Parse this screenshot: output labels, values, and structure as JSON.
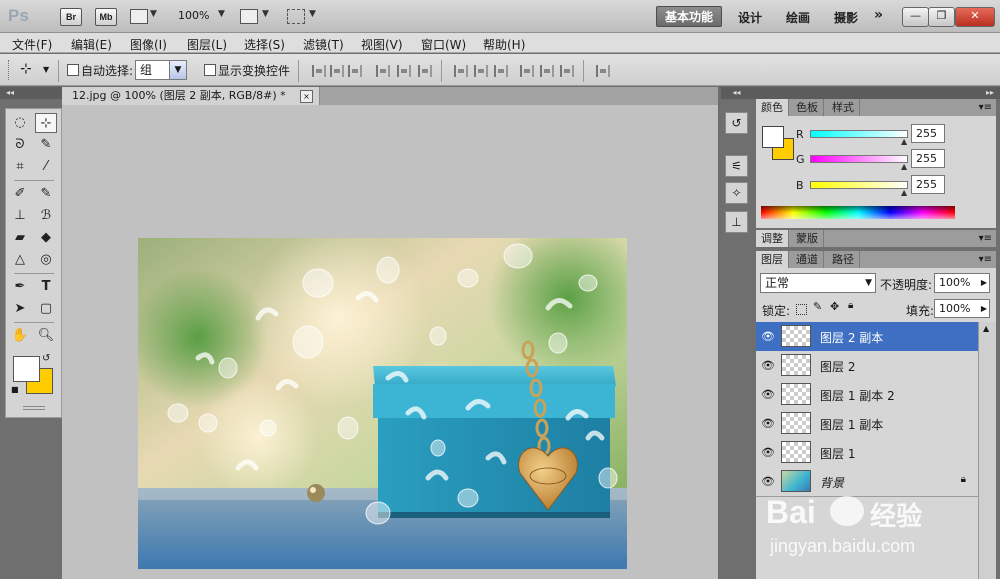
{
  "app": {
    "logo": "Ps",
    "bridge_label": "Br",
    "minibridge_label": "Mb",
    "zoom": "100%",
    "workspaces": [
      "基本功能",
      "设计",
      "绘画",
      "摄影"
    ],
    "more": "»",
    "window_buttons": {
      "minimize": "—",
      "restore": "❐",
      "close": "✕"
    }
  },
  "menu": [
    "文件(F)",
    "编辑(E)",
    "图像(I)",
    "图层(L)",
    "选择(S)",
    "滤镜(T)",
    "视图(V)",
    "窗口(W)",
    "帮助(H)"
  ],
  "options": {
    "auto_select_label": "自动选择:",
    "auto_select_value": "组",
    "show_transform_label": "显示变换控件"
  },
  "document": {
    "tab_title": "12.jpg @ 100% (图层 2 副本, RGB/8#) *",
    "close": "×"
  },
  "color_panel": {
    "tabs": [
      "颜色",
      "色板",
      "样式"
    ],
    "channels": [
      {
        "label": "R",
        "value": "255"
      },
      {
        "label": "G",
        "value": "255"
      },
      {
        "label": "B",
        "value": "255"
      }
    ],
    "foreground": "#ffffff",
    "background": "#ffcc00"
  },
  "adjust_panel": {
    "tabs": [
      "调整",
      "蒙版"
    ]
  },
  "layers_panel": {
    "tabs": [
      "图层",
      "通道",
      "路径"
    ],
    "blend_mode": "正常",
    "opacity_label": "不透明度:",
    "opacity_value": "100%",
    "lock_label": "锁定:",
    "fill_label": "填充:",
    "fill_value": "100%",
    "layers": [
      {
        "name": "图层 2 副本",
        "selected": true
      },
      {
        "name": "图层 2",
        "selected": false
      },
      {
        "name": "图层 1 副本 2",
        "selected": false
      },
      {
        "name": "图层 1 副本",
        "selected": false
      },
      {
        "name": "图层 1",
        "selected": false
      },
      {
        "name": "背景",
        "selected": false,
        "locked": true
      }
    ]
  },
  "watermark": {
    "brand": "Bai",
    "brand2": "经验",
    "url": "jingyan.baidu.com"
  },
  "colors": {
    "selected_layer": "#3f6fc3",
    "accent": "#ffcc00"
  }
}
